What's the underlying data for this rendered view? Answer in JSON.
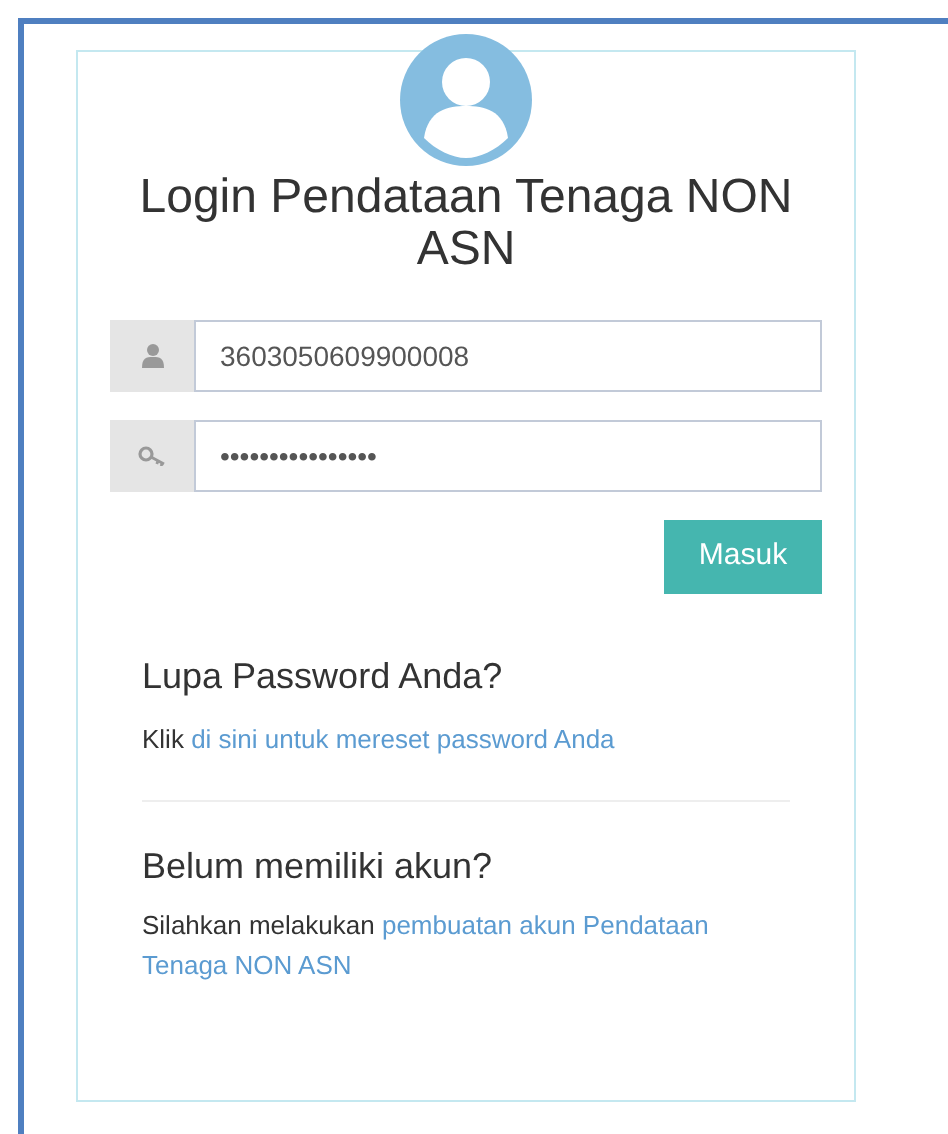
{
  "title": "Login Pendataan Tenaga NON ASN",
  "fields": [
    {
      "kind": "user",
      "value": "3603050609900008"
    },
    {
      "kind": "password",
      "value": "••••••••••••••••"
    }
  ],
  "submit_button": "Masuk",
  "forgot": {
    "heading": "Lupa Password Anda?",
    "text": "Klik",
    "link_lines": [
      "di sini untuk mereset password Anda"
    ]
  },
  "register": {
    "heading": "Belum memiliki akun?",
    "text": "Silahkan melakukan",
    "link_lines": [
      "pembuatan akun Pendataan",
      "Tenaga NON ASN"
    ]
  }
}
